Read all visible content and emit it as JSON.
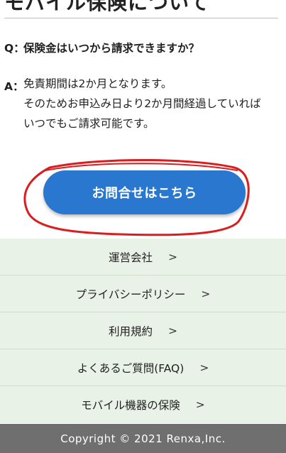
{
  "page": {
    "title": "モバイル保険について"
  },
  "faq": {
    "question_marker": "Q：",
    "question": "保険金はいつから請求できますか？",
    "answer_marker": "A：",
    "answer_lines": [
      "免責期間は2か月となります。",
      "そのためお申込み日より2か月間経過していれば",
      "いつでもご請求可能です。"
    ]
  },
  "cta": {
    "label": "お問合せはこちら",
    "color": "#2a77cf",
    "annotation_color": "#d81e1e"
  },
  "footer": {
    "links": [
      {
        "label": "運営会社",
        "arrow": ">"
      },
      {
        "label": "プライバシーポリシー",
        "arrow": ">"
      },
      {
        "label": "利用規約",
        "arrow": ">"
      },
      {
        "label": "よくあるご質問(FAQ)",
        "arrow": ">"
      },
      {
        "label": "モバイル機器の保険",
        "arrow": ">"
      }
    ],
    "background": "#e9f2e6",
    "copyright": "Copyright © 2021 Renxa,Inc."
  }
}
